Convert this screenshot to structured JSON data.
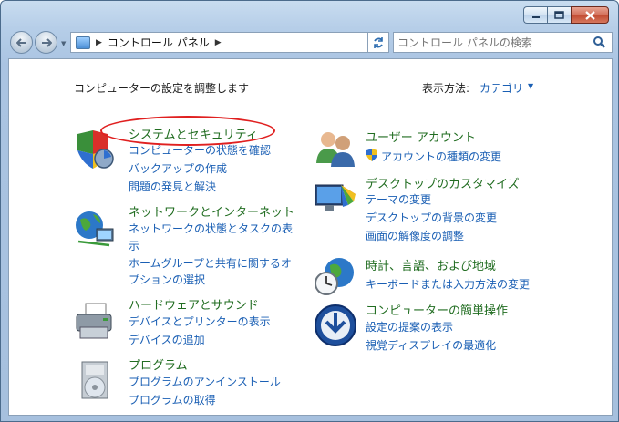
{
  "window": {
    "controls": {
      "minimize_icon": "minimize-icon",
      "maximize_icon": "maximize-icon",
      "close_icon": "close-icon"
    }
  },
  "navbar": {
    "address_segment": "コントロール パネル",
    "search_placeholder": "コントロール パネルの検索"
  },
  "header": {
    "intro": "コンピューターの設定を調整します",
    "view_by_label": "表示方法:",
    "view_by_value": "カテゴリ"
  },
  "categories_left": [
    {
      "title": "システムとセキュリティ",
      "icon": "shield-icon",
      "links": [
        "コンピューターの状態を確認",
        "バックアップの作成",
        "問題の発見と解決"
      ]
    },
    {
      "title": "ネットワークとインターネット",
      "icon": "globe-network-icon",
      "links": [
        "ネットワークの状態とタスクの表",
        "示",
        "ホームグループと共有に関するオ",
        "プションの選択"
      ]
    },
    {
      "title": "ハードウェアとサウンド",
      "icon": "printer-icon",
      "links": [
        "デバイスとプリンターの表示",
        "デバイスの追加"
      ]
    },
    {
      "title": "プログラム",
      "icon": "programs-icon",
      "links": [
        "プログラムのアンインストール",
        "プログラムの取得"
      ]
    }
  ],
  "categories_right": [
    {
      "title": "ユーザー アカウント",
      "icon": "users-icon",
      "links": [
        "アカウントの種類の変更"
      ]
    },
    {
      "title": "デスクトップのカスタマイズ",
      "icon": "display-palette-icon",
      "links": [
        "テーマの変更",
        "デスクトップの背景の変更",
        "画面の解像度の調整"
      ]
    },
    {
      "title": "時計、言語、および地域",
      "icon": "clock-globe-icon",
      "links": [
        "キーボードまたは入力方法の変更"
      ]
    },
    {
      "title": "コンピューターの簡単操作",
      "icon": "ease-of-access-icon",
      "links": [
        "設定の提案の表示",
        "視覚ディスプレイの最適化"
      ]
    }
  ],
  "colors": {
    "title_green": "#216d21",
    "link_blue": "#1a5fb4",
    "annotation_red": "#e02020"
  }
}
